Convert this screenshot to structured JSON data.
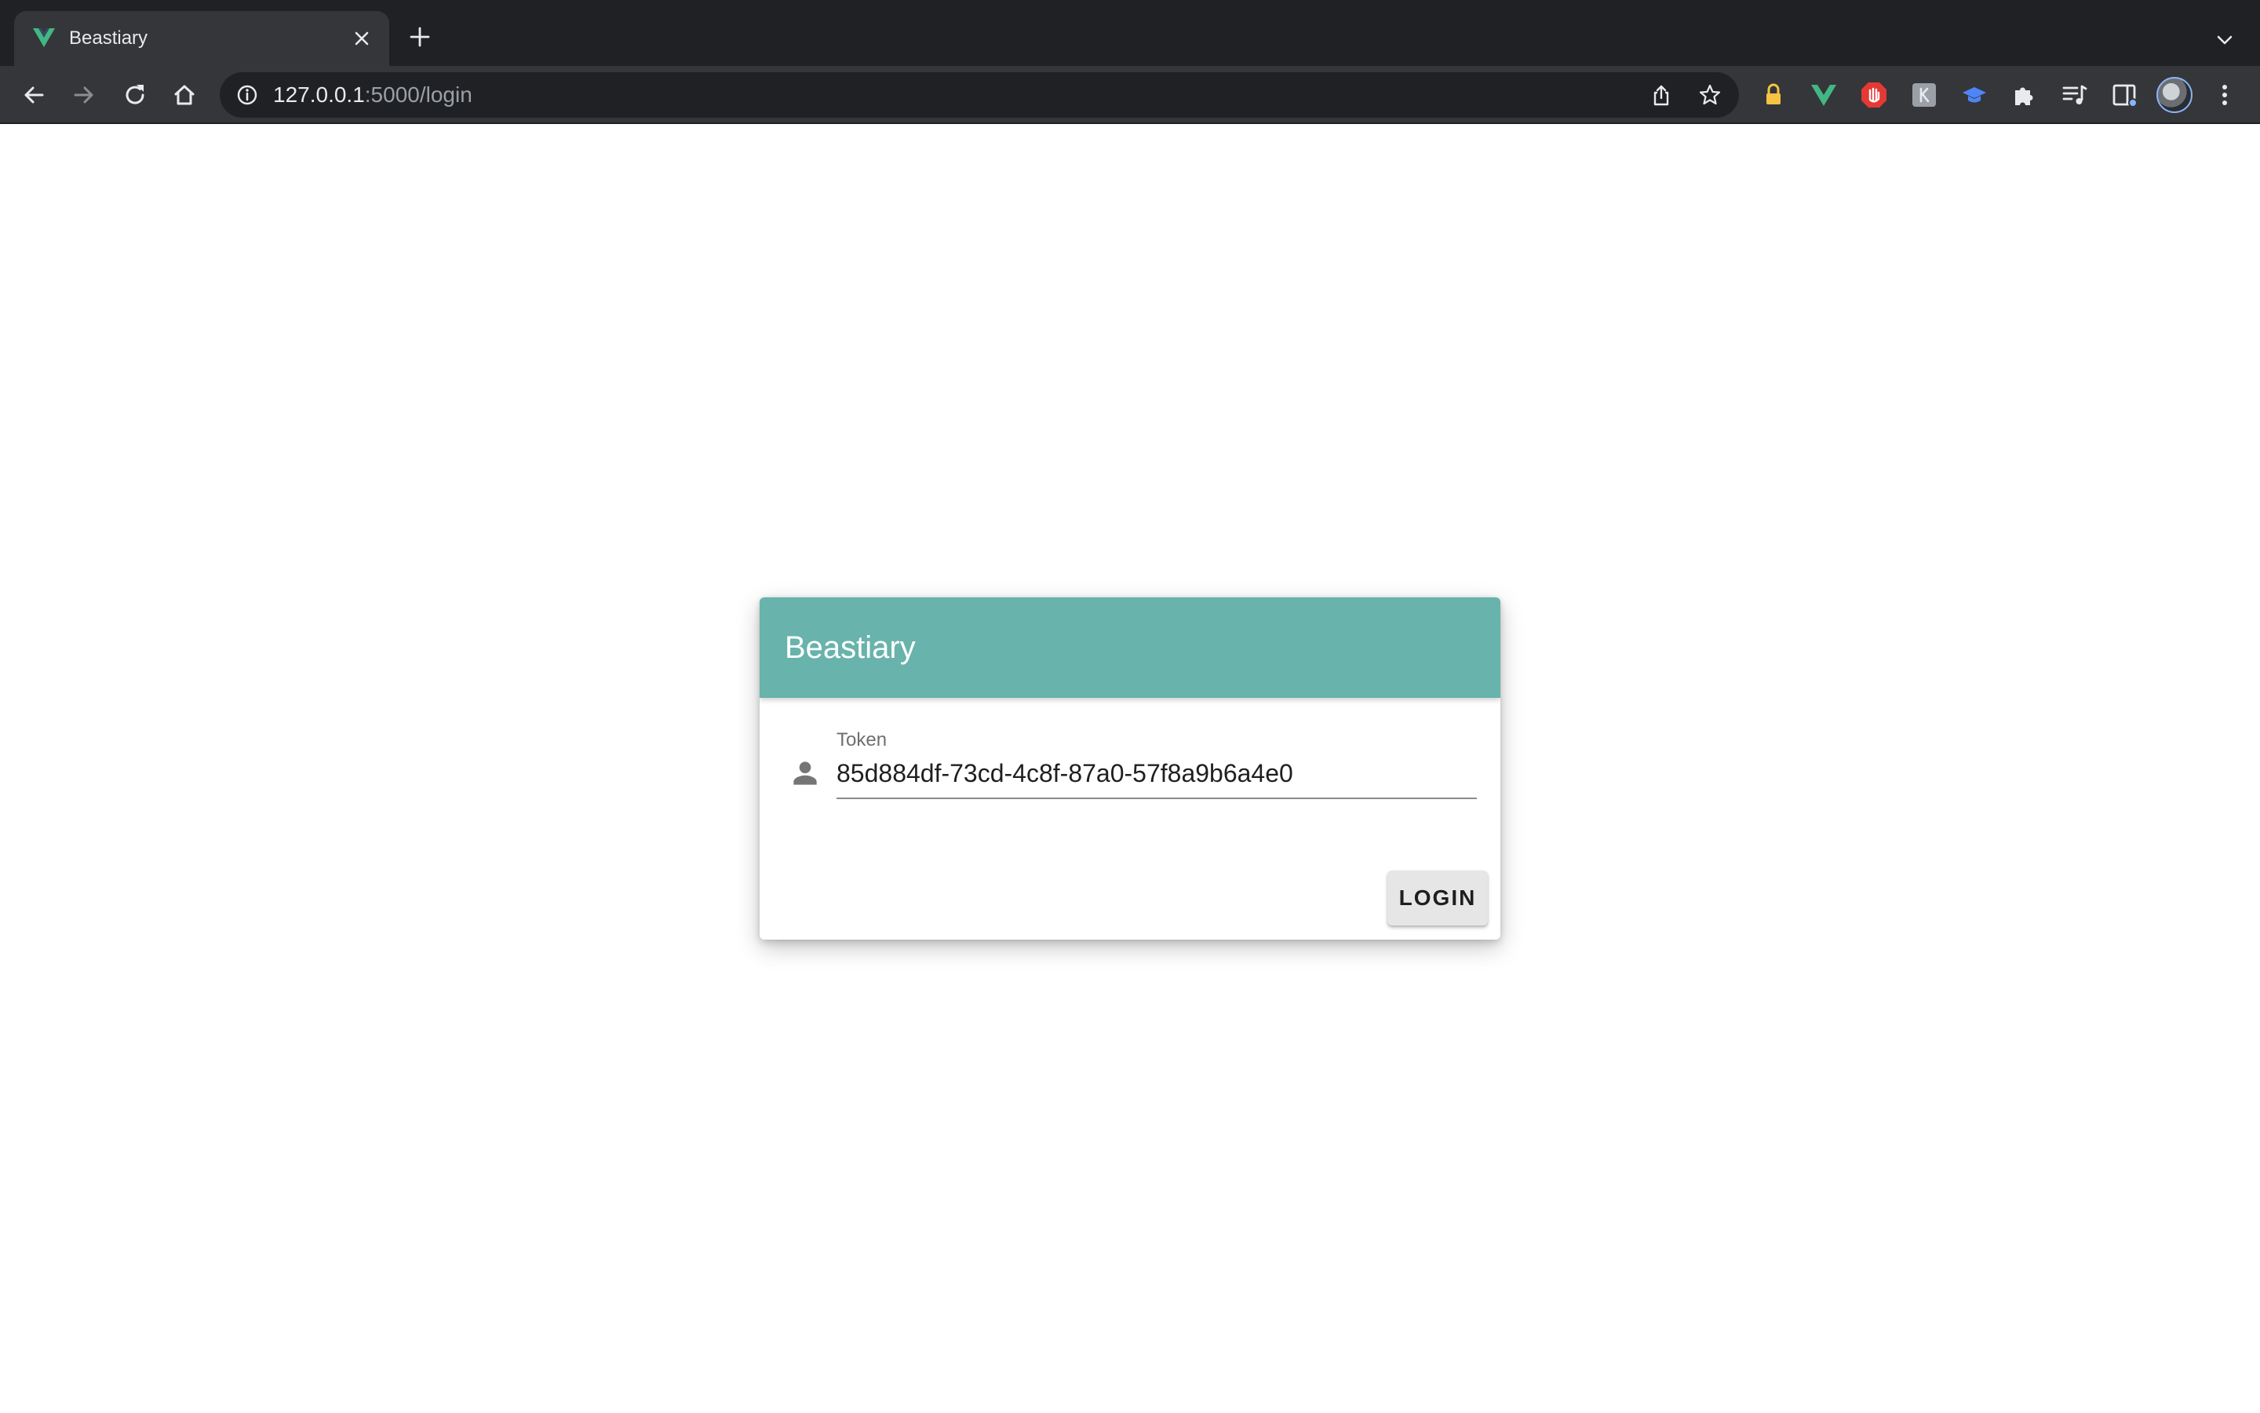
{
  "browser": {
    "tab": {
      "title": "Beastiary",
      "favicon": "vue-logo-icon"
    },
    "address_bar": {
      "host": "127.0.0.1",
      "path": ":5000/login"
    },
    "extensions": [
      "lock-extension-icon",
      "vue-devtools-icon",
      "adblock-icon",
      "grey-k-extension-icon",
      "blue-graduation-cap-icon",
      "puzzle-icon",
      "media-control-icon",
      "side-panel-icon"
    ]
  },
  "login_card": {
    "title": "Beastiary",
    "token_label": "Token",
    "token_value": "85d884df-73cd-4c8f-87a0-57f8a9b6a4e0",
    "login_label": "LOGIN"
  },
  "colors": {
    "header": "#68b3ac",
    "chrome_dark": "#202124",
    "chrome_toolbar": "#35363a"
  }
}
